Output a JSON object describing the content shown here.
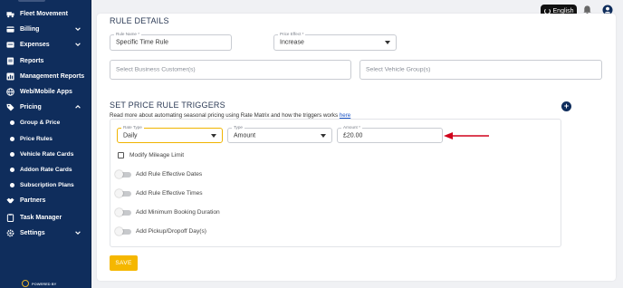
{
  "sidebar": {
    "items": [
      {
        "label": "Fleet Movement",
        "icon": "truck-icon",
        "expandable": false
      },
      {
        "label": "Billing",
        "icon": "billing-icon",
        "expandable": true
      },
      {
        "label": "Expenses",
        "icon": "expenses-icon",
        "expandable": true
      },
      {
        "label": "Reports",
        "icon": "reports-icon",
        "expandable": false
      },
      {
        "label": "Management Reports",
        "icon": "chart-icon",
        "expandable": false
      },
      {
        "label": "Web/Mobile Apps",
        "icon": "globe-icon",
        "expandable": false
      },
      {
        "label": "Pricing",
        "icon": "tag-icon",
        "expandable": true,
        "expanded": true
      },
      {
        "label": "Partners",
        "icon": "handshake-icon",
        "expandable": false
      },
      {
        "label": "Task Manager",
        "icon": "clipboard-icon",
        "expandable": false
      },
      {
        "label": "Settings",
        "icon": "gear-icon",
        "expandable": true
      }
    ],
    "pricing_sub": [
      "Group & Price",
      "Price Rules",
      "Vehicle Rate Cards",
      "Addon Rate Cards",
      "Subscription Plans"
    ],
    "powered_by": "POWERED BY"
  },
  "header": {
    "language_label": "English",
    "icons": [
      "language-icon",
      "bell-icon",
      "user-icon"
    ]
  },
  "rule_details": {
    "title": "RULE DETAILS",
    "rule_name": {
      "label": "Rule Name *",
      "value": "Specific Time Rule"
    },
    "price_effect": {
      "label": "Price Effect *",
      "value": "Increase"
    },
    "business_customers": {
      "placeholder": "Select Business Customer(s)"
    },
    "vehicle_groups": {
      "placeholder": "Select Vehicle Group(s)"
    }
  },
  "triggers": {
    "title": "SET PRICE RULE TRIGGERS",
    "description": "Read more about automating seasonal pricing using Rate Matrix and how the triggers works",
    "link_text": "here",
    "rate_type": {
      "label": "Rate Type",
      "value": "Daily"
    },
    "type": {
      "label": "Type",
      "value": "Amount"
    },
    "amount": {
      "label": "Amount *",
      "value": "£20.00"
    },
    "modify_mileage": {
      "label": "Modify Mileage Limit",
      "checked": false
    },
    "toggles": [
      {
        "label": "Add Rule Effective Dates",
        "on": false
      },
      {
        "label": "Add Rule Effective Times",
        "on": false
      },
      {
        "label": "Add Minimum Booking Duration",
        "on": false
      },
      {
        "label": "Add Pickup/Dropoff Day(s)",
        "on": false
      }
    ]
  },
  "actions": {
    "save_label": "SAVE"
  },
  "colors": {
    "sidebar": "#0f2d5c",
    "accent": "#f5b700",
    "annotation_arrow": "#d0021b",
    "link": "#1a53c5"
  }
}
